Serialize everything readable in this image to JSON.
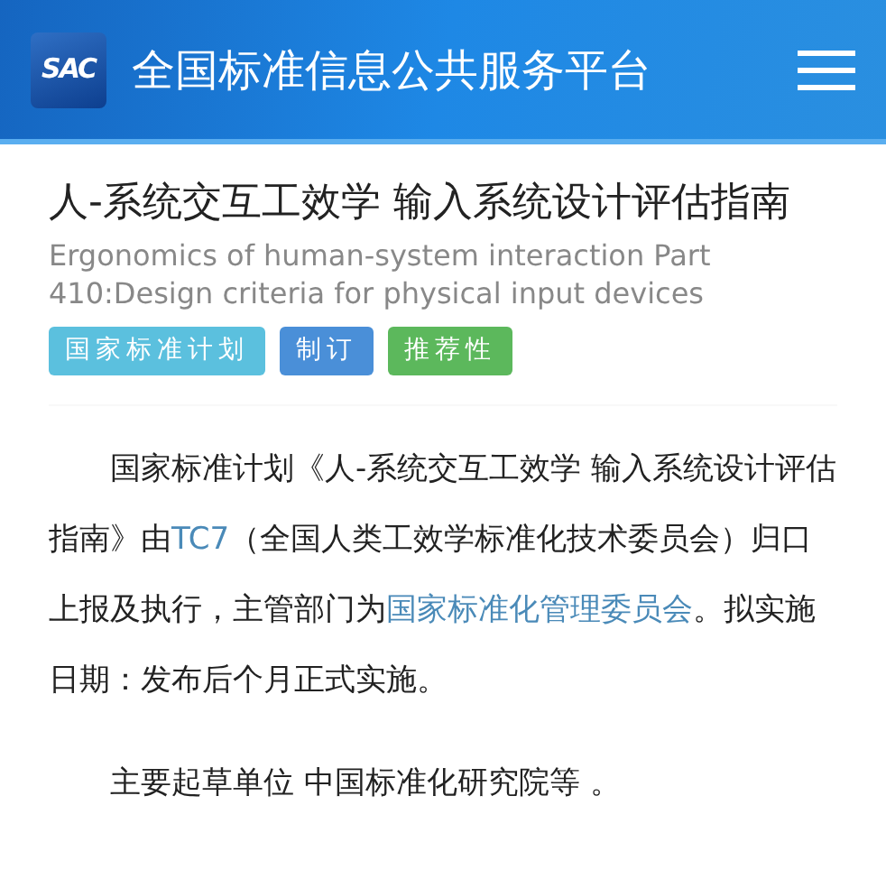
{
  "header": {
    "logo": "SAC",
    "title": "全国标准信息公共服务平台"
  },
  "standard": {
    "title": "人-系统交互工效学 输入系统设计评估指南",
    "english_title": "Ergonomics of human-system interaction Part 410:Design criteria for physical input devices",
    "tags": [
      {
        "label": "国家标准计划",
        "color": "#5bc0de"
      },
      {
        "label": "制订",
        "color": "#4a8fd8"
      },
      {
        "label": "推荐性",
        "color": "#5cb85c"
      }
    ]
  },
  "paragraphs": [
    {
      "segments": [
        {
          "kind": "text",
          "text": "国家标准计划《人-系统交互工效学 输入系统设计评估指南》由"
        },
        {
          "kind": "link",
          "text": "TC7"
        },
        {
          "kind": "text",
          "text": "（全国人类工效学标准化技术委员会）归口上报及执行，主管部门为"
        },
        {
          "kind": "link",
          "text": "国家标准化管理委员会"
        },
        {
          "kind": "text",
          "text": "。拟实施日期：发布后个月正式实施。"
        }
      ]
    },
    {
      "segments": [
        {
          "kind": "text",
          "text": "主要起草单位 中国标准化研究院等 。"
        }
      ]
    }
  ]
}
